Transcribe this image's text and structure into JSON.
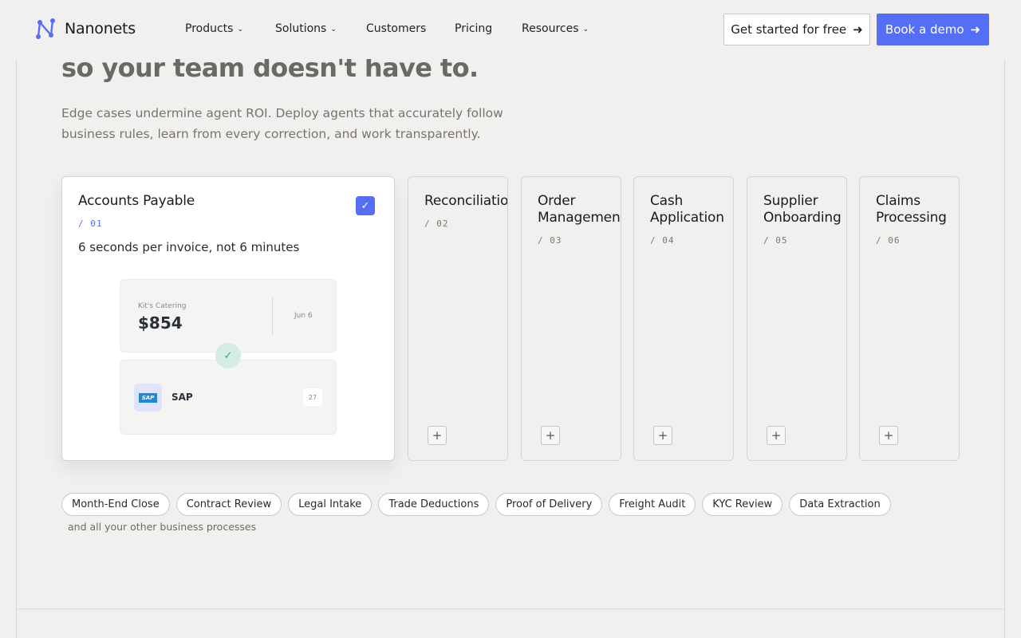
{
  "nav": {
    "brand": "Nanonets",
    "links": [
      {
        "label": "Products",
        "has_dropdown": true
      },
      {
        "label": "Solutions",
        "has_dropdown": true
      },
      {
        "label": "Customers",
        "has_dropdown": false
      },
      {
        "label": "Pricing",
        "has_dropdown": false
      },
      {
        "label": "Resources",
        "has_dropdown": true
      }
    ],
    "cta_secondary": "Get started for free",
    "cta_primary": "Book a demo",
    "accent_color": "#546ef5"
  },
  "hero": {
    "title_line": "so your team doesn't have to.",
    "description": "Edge cases undermine agent ROI. Deploy agents that accurately follow business rules, learn from every correction, and work transparently."
  },
  "cards": {
    "active": {
      "title": "Accounts Payable",
      "number": "/ 01",
      "subtitle": "6 seconds per invoice, not 6 minutes",
      "checked": true,
      "invoice": {
        "vendor": "Kit's Catering",
        "amount": "$854",
        "date": "Jun 6",
        "erp_label": "SAP",
        "erp_logo": "SAP",
        "erp_badge": "27"
      }
    },
    "collapsed": [
      {
        "title": "Reconciliation",
        "number": "/ 02"
      },
      {
        "title": "Order Management",
        "number": "/ 03"
      },
      {
        "title": "Cash Application",
        "number": "/ 04"
      },
      {
        "title": "Supplier Onboarding",
        "number": "/ 05"
      },
      {
        "title": "Claims Processing",
        "number": "/ 06"
      }
    ]
  },
  "tags": {
    "items": [
      "Month-End Close",
      "Contract Review",
      "Legal Intake",
      "Trade Deductions",
      "Proof of Delivery",
      "Freight Audit",
      "KYC Review",
      "Data Extraction"
    ],
    "note": "and all your other business processes"
  }
}
